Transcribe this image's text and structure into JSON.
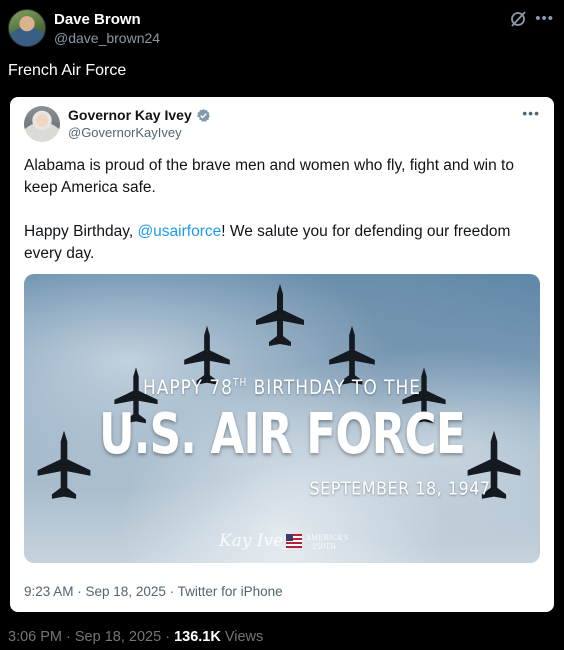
{
  "outer_post": {
    "author_name": "Dave Brown",
    "author_handle": "@dave_brown24",
    "text": "French Air Force",
    "footer": {
      "time": "3:06 PM",
      "separator1": " · ",
      "date": "Sep 18, 2025",
      "separator2": " · ",
      "views_count": "136.1K",
      "views_label": " Views"
    }
  },
  "quoted_post": {
    "author_name": "Governor Kay Ivey",
    "author_handle": "@GovernorKayIvey",
    "paragraph1": "Alabama is proud of the brave men and women who fly, fight and win to keep America safe.",
    "paragraph2_before": "Happy Birthday, ",
    "mention": "@usairforce",
    "paragraph2_after": "! We salute you for defending our freedom every day.",
    "meta": "9:23 AM · Sep 18, 2025 · Twitter for iPhone",
    "image": {
      "line1_prefix": "HAPPY 78",
      "line1_sup": "TH",
      "line1_suffix": " BIRTHDAY TO THE",
      "line2": "U.S. AIR FORCE",
      "line3": "SEPTEMBER 18, 1947",
      "signature": "Kay Ivey",
      "logo_line1": "AMERICA'S",
      "logo_line2": "250TH"
    }
  },
  "icons": {
    "verified_color": "#829aab",
    "link_color": "#1d9bf0"
  }
}
